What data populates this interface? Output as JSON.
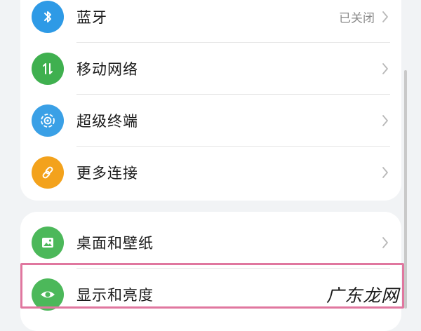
{
  "settings_groups": [
    {
      "items": [
        {
          "label": "蓝牙",
          "value": "已关闭",
          "icon": "bluetooth-icon",
          "color": "#2e9ae6"
        },
        {
          "label": "移动网络",
          "value": "",
          "icon": "mobile-network-icon",
          "color": "#3fb04f"
        },
        {
          "label": "超级终端",
          "value": "",
          "icon": "super-device-icon",
          "color": "#3aa0e6"
        },
        {
          "label": "更多连接",
          "value": "",
          "icon": "link-icon",
          "color": "#f3a21c"
        }
      ]
    },
    {
      "items": [
        {
          "label": "桌面和壁纸",
          "value": "",
          "icon": "wallpaper-icon",
          "color": "#4cb85a"
        },
        {
          "label": "显示和亮度",
          "value": "",
          "icon": "eye-icon",
          "color": "#4cb85a"
        }
      ]
    }
  ],
  "highlight_color": "#e0779f",
  "watermark": "广东龙网"
}
